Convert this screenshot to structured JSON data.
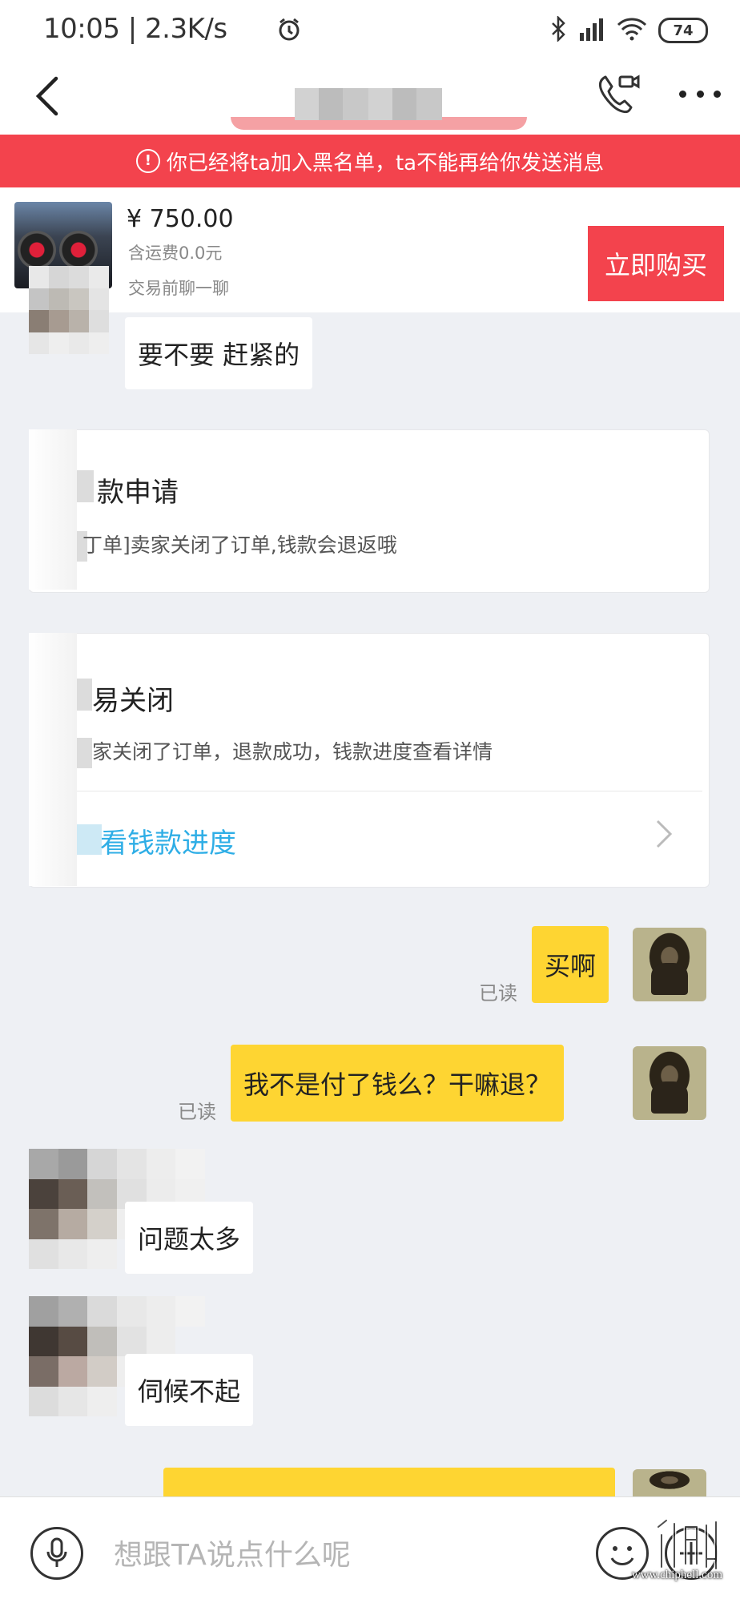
{
  "status_bar": {
    "time_speed": "10:05 | 2.3K/s",
    "battery": "74"
  },
  "banner": {
    "icon": "!",
    "text": "你已经将ta加入黑名单，ta不能再给你发送消息"
  },
  "product": {
    "price": "¥ 750.00",
    "shipping": "含运费0.0元",
    "chat_before_trade": "交易前聊一聊",
    "buy_label": "立即购买"
  },
  "messages": {
    "m1": "要不要 赶紧的",
    "refund_card": {
      "title": "款申请",
      "desc": "丁单]卖家关闭了订单,钱款会退返哦"
    },
    "closed_card": {
      "title": "易关闭",
      "desc": "家关闭了订单，退款成功，钱款进度查看详情",
      "link": "看钱款进度"
    },
    "m2": "买啊",
    "m2_read": "已读",
    "m3": "我不是付了钱么？干嘛退？",
    "m3_read": "已读",
    "m4": "问题太多",
    "m5": "伺候不起"
  },
  "input": {
    "placeholder": "想跟TA说点什么呢"
  },
  "watermark": {
    "site": "www.chiphell.com"
  },
  "colors": {
    "accent_red": "#f3434d",
    "bubble_yellow": "#fed532",
    "link_blue": "#2faee6"
  }
}
